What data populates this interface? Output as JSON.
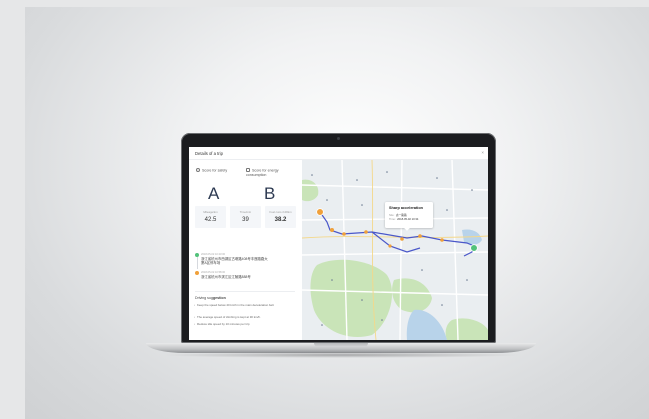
{
  "dialog": {
    "title": "Details of a trip",
    "close_symbol": "×"
  },
  "scores": {
    "safety_label": "Score for safety",
    "safety_grade": "A",
    "energy_label": "Score for energy consumption",
    "energy_grade": "B"
  },
  "stats": [
    {
      "label": "Mileage/km",
      "value": "42.5"
    },
    {
      "label": "Time/min",
      "value": "39"
    },
    {
      "label": "Fuel cons./100km",
      "value": "38.2"
    }
  ],
  "events": [
    {
      "time": "2018-05-02 10:23:00",
      "text": "浙江省杭州市西湖区古墩路408号丰莲路路大厦A区停车场",
      "color": "#52c27a"
    },
    {
      "time": "2018-05-02 10:58:00",
      "text": "浙江省杭州市滨江区江陵路888号",
      "color": "#f0a03a"
    }
  ],
  "suggestions": {
    "title_prefix": "Driving sug",
    "title_suffix": "gestion",
    "items": [
      "Keep the speed below 40 km/h in the main deceleration belt",
      "The average speed of climbing is kept at 30 km/h.",
      "Reduce idle speed by 10 minutes per trip"
    ]
  },
  "map": {
    "tooltip": {
      "title": "Sharp acceleration",
      "site_label": "Site:",
      "site_value": "古一路路",
      "time_label": "Time:",
      "time_value": "2018-05-02 10:34"
    },
    "route_color": "#4a57c9",
    "event_marker_color": "#f0a03a",
    "start_marker_color": "#f0a03a",
    "end_marker_color": "#52c27a",
    "park_color": "#c9e4b8",
    "water_color": "#b8d3ea"
  }
}
